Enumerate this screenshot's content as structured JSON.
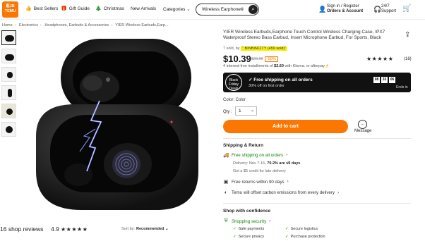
{
  "header": {
    "logo_text": "逛JB TEMU",
    "nav": [
      {
        "icon": "thumbs-up-icon",
        "label": "Best Sellers"
      },
      {
        "icon": "gift-icon",
        "label": "Gift Guide"
      },
      {
        "icon": "tree-icon",
        "label": "Christmas"
      },
      {
        "icon": "",
        "label": "New Arrivals"
      },
      {
        "icon": "",
        "label": "Categories ⌄"
      }
    ],
    "search_value": "Wireless Earphones",
    "account_line1": "Sign in / Register",
    "account_line2": "Orders & Account",
    "support_line1": "24/7",
    "support_line2": "Support"
  },
  "breadcrumb": [
    "Home",
    "Electronics",
    "Headphones, Earbuds & Accessories",
    "YIER Wireless Earbuds,Earp..."
  ],
  "product": {
    "title": "YIER Wireless Earbuds,Earphone Touch Control Wireless Charging Case, IPX7 Waterproof Stereo Bass Earbud, Insert Microphone Earbud, For Sports, Black",
    "sold": "7 sold, by",
    "store": "\" BINBINCITY (459 sold)\"",
    "price": "$10.39",
    "original_price": "$20.99",
    "discount": "-50%",
    "rating_stars": "★★★★★",
    "rating_count": "(16)",
    "installments_pre": "4 interest-free installments of ",
    "installments_amount": "$2.60",
    "installments_post": " with Klarna. or afterpay⚡",
    "promo_badge": "Black Friday Deals",
    "promo_line1": "Free shipping on all orders",
    "promo_line2": "30% off on first order",
    "timer": [
      "08",
      "33",
      "06"
    ],
    "timer_label": "Ends in",
    "color_label": "Color: Color",
    "qty_label": "Qty :",
    "qty_value": "1",
    "add_to_cart": "Add to cart",
    "message_label": "Message"
  },
  "shipping": {
    "title": "Shipping & Return",
    "free_shipping": "Free shipping on all orders",
    "delivery_pre": "Delivery: Nov 7-16, ",
    "delivery_bold": "70.2% are ≤9 days",
    "credit": "Get a $5 credit for late delivery",
    "returns": "Free returns within 90 days",
    "carbon": "Temu will offset carbon emissions from every delivery"
  },
  "confidence": {
    "title": "Shop with confidence",
    "security": "Shopping security",
    "items": [
      "Safe payments",
      "Secure logistics",
      "Secure privacy",
      "Purchase protection"
    ]
  },
  "reviews": {
    "title": "16 shop reviews",
    "rating": "4.9",
    "stars": "★★★★★",
    "sort_label": "Sort by:",
    "sort_value": "Recommended ⌄"
  },
  "colors": {
    "accent": "#fb7701",
    "green": "#0a8800",
    "highlight": "#f8ef00"
  }
}
